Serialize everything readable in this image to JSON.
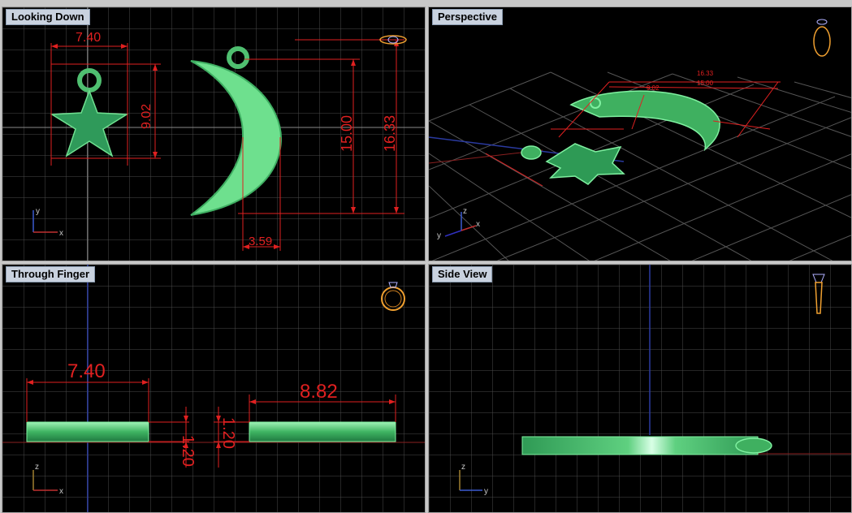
{
  "viewports": {
    "top": {
      "title": "Looking Down",
      "dims": {
        "width": "7.40",
        "height": "9.02",
        "moon_inner": "15.00",
        "moon_total": "16.33",
        "moon_width": "3.59"
      },
      "axes": {
        "v": "y",
        "h": "x"
      }
    },
    "persp": {
      "title": "Perspective",
      "axes": {
        "v": "z",
        "h1": "y",
        "h2": "x"
      }
    },
    "front": {
      "title": "Through Finger",
      "dims": {
        "star_width": "7.40",
        "moon_width": "8.82",
        "thick_a": "1.20",
        "thick_b": "1.20"
      },
      "axes": {
        "v": "z",
        "h": "x"
      }
    },
    "side": {
      "title": "Side View",
      "axes": {
        "v": "z",
        "h": "y"
      }
    }
  },
  "colors": {
    "background": "#000000",
    "grid": "#5a5a5a",
    "dimension": "#e02020",
    "model": "#5fcf82",
    "label_bg": "#c9d2df"
  }
}
